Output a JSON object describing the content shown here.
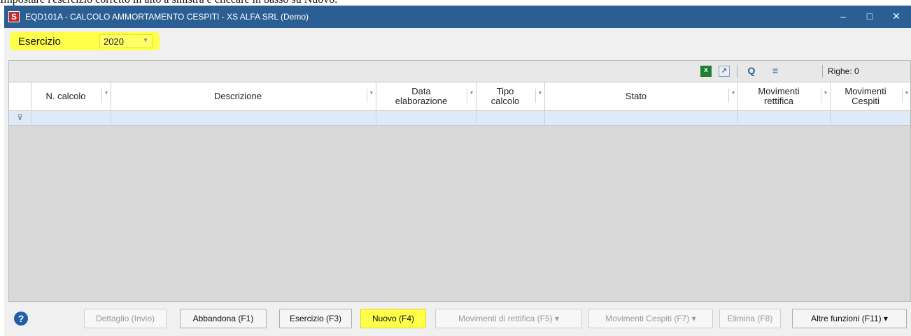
{
  "caption": "Impostare l'esercizio corretto in alto a sinistra e cliccare in basso su Nuovo.",
  "window": {
    "title": "EQD101A - CALCOLO AMMORTAMENTO CESPITI - XS ALFA SRL  (Demo)",
    "app_icon_glyph": "S",
    "minimize_glyph": "–",
    "maximize_glyph": "□",
    "close_glyph": "✕"
  },
  "esercizio": {
    "label": "Esercizio",
    "value": "2020",
    "arrow": "▼"
  },
  "toolbar": {
    "excel_glyph": "x",
    "export_glyph": "↗",
    "search_glyph": "Q",
    "columns_glyph": "≡",
    "righe_text": "Righe: 0"
  },
  "grid": {
    "columns": [
      {
        "label": "N. calcolo"
      },
      {
        "label": "Descrizione"
      },
      {
        "label": "Data\nelaborazione"
      },
      {
        "label": "Tipo\ncalcolo"
      },
      {
        "label": "Stato"
      },
      {
        "label": "Movimenti\nrettifica"
      },
      {
        "label": "Movimenti\nCespiti"
      }
    ],
    "rows": [],
    "filter_glyph": "⊽"
  },
  "footer": {
    "help_glyph": "?",
    "buttons": {
      "dettaglio": "Dettaglio (Invio)",
      "abbandona": "Abbandona (F1)",
      "esercizio": "Esercizio (F3)",
      "nuovo": "Nuovo (F4)",
      "movimenti_rettifica": "Movimenti di rettifica (F5) ▾",
      "movimenti_cespiti": "Movimenti Cespiti (F7) ▾",
      "elimina": "Elimina (F8)",
      "altre_funzioni": "Altre funzioni (F11) ▾"
    }
  },
  "colors": {
    "titlebar": "#2b5f93",
    "highlight": "#ffff4a",
    "filter_row": "#dfeaf8",
    "grid_background": "#d9d9d9"
  }
}
